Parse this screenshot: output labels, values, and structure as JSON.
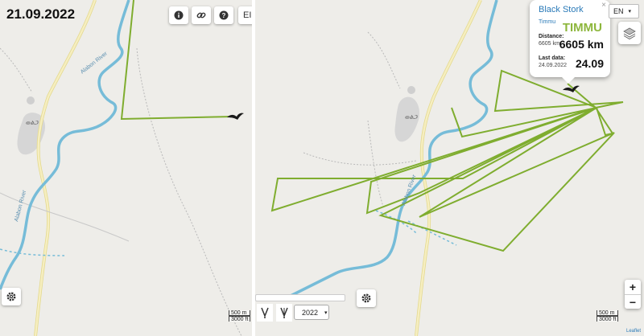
{
  "left_panel": {
    "date_title": "21.09.2022",
    "lang_label": "EI",
    "town_label": "ወልጋ",
    "scale": {
      "metric": "500 m",
      "imperial": "3000 ft"
    }
  },
  "right_panel": {
    "town_label": "ወልጋ",
    "popup": {
      "close": "×",
      "species": "Black Stork",
      "ident": "Timmu",
      "name": "TIMMU",
      "distance_label": "Distance:",
      "distance_small": "6605 km",
      "distance_big": "6605 km",
      "lastdata_label": "Last data:",
      "lastdata_small": "24.09.2022",
      "lastdata_big": "24.09"
    },
    "language": "EN",
    "year": "2022",
    "zoom_in": "+",
    "zoom_out": "−",
    "scale": {
      "metric": "500 m",
      "imperial": "3000 ft"
    },
    "attribution": "Leaflet"
  },
  "river_labels": [
    "Alabon River",
    "Alabon River"
  ],
  "colors": {
    "track": "#7fad2f",
    "river": "#76bcd8",
    "road": "#f1e7a2",
    "land": "#eeede9",
    "urban": "#d4d4d4"
  },
  "icons": [
    "info-icon",
    "link-icon",
    "help-icon",
    "gear-icon",
    "layers-icon",
    "bird-icon"
  ]
}
